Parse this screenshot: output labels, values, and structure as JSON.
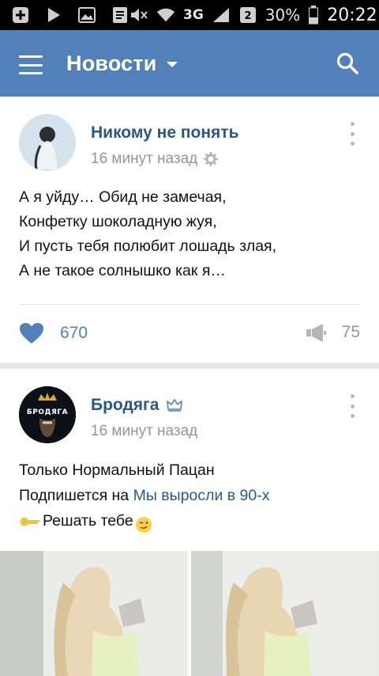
{
  "status_bar": {
    "battery": "30%",
    "time": "20:22",
    "network": "3G",
    "icons": [
      "plus-icon",
      "play-icon",
      "image-icon",
      "document-icon",
      "mute-icon",
      "wifi-icon",
      "signal-icon",
      "sim-icon",
      "battery-icon"
    ]
  },
  "app_bar": {
    "title": "Новости",
    "color": "#5181b8",
    "icons": [
      "menu-icon",
      "caret-down-icon",
      "search-icon"
    ]
  },
  "feed": {
    "posts": [
      {
        "author": "Никому не понять",
        "time": "16 минут назад",
        "lines": [
          "А я уйду… Обид не замечая,",
          "Конфетку шоколадную жуя,",
          "И пусть тебя полюбит лошадь злая,",
          "А не такое солнышко как я…"
        ],
        "likes": "670",
        "shares": "75"
      },
      {
        "author": "Бродяга",
        "time": "16 минут назад",
        "avatar_text": "БРОДЯГА",
        "line1": "Только Нормальный Пацан",
        "line2_prefix": "Подпишется на ",
        "line2_link": "Мы выросли в 90-х",
        "line3": "Решать тебе"
      }
    ]
  }
}
